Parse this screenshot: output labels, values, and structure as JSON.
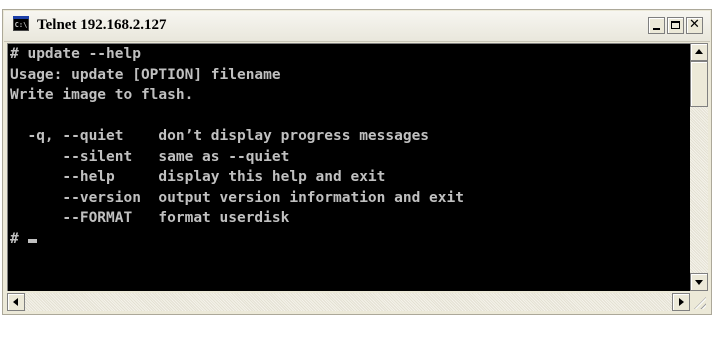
{
  "window": {
    "title": "Telnet 192.168.2.127",
    "icon_label": "C:\\"
  },
  "console": {
    "lines": [
      "# update --help",
      "Usage: update [OPTION] filename",
      "Write image to flash.",
      "",
      "  -q, --quiet    don’t display progress messages",
      "      --silent   same as --quiet",
      "      --help     display this help and exit",
      "      --version  output version information and exit",
      "      --FORMAT   format userdisk"
    ],
    "prompt": "# ",
    "foreground_color": "#c0c0c0",
    "background_color": "#000000"
  },
  "icons": {
    "app": "console-icon",
    "minimize": "minimize-icon",
    "maximize": "maximize-icon",
    "close": "close-icon",
    "scroll_up": "arrow-up-icon",
    "scroll_down": "arrow-down-icon",
    "scroll_left": "arrow-left-icon",
    "scroll_right": "arrow-right-icon",
    "resize": "resize-grip-icon"
  }
}
